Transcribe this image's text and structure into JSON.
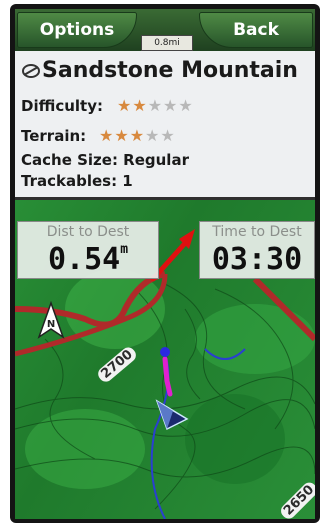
{
  "topbar": {
    "options_label": "Options",
    "back_label": "Back",
    "scale_text": "0.8mi"
  },
  "cache": {
    "name": "Sandstone Mountain",
    "difficulty_label": "Difficulty:",
    "difficulty_stars": 2,
    "terrain_label": "Terrain:",
    "terrain_stars": 3,
    "max_stars": 5,
    "size_text": "Cache Size: Regular",
    "trackables_text": "Trackables: 1"
  },
  "fields": {
    "dist_label": "Dist to Dest",
    "dist_value": "0.54",
    "dist_unit": "m",
    "time_label": "Time to Dest",
    "time_value": "03:30"
  },
  "map": {
    "contour_labels": [
      "2700",
      "2650"
    ]
  },
  "colors": {
    "star_full": "#d8893e",
    "star_empty": "#b8b8b8",
    "route": "#e020d0",
    "annotation_arrow": "#e01010",
    "boundary": "#b02a2a"
  },
  "icons": {
    "north": "north-arrow-icon",
    "position": "position-arrow-icon",
    "geocache": "geocache-icon"
  }
}
